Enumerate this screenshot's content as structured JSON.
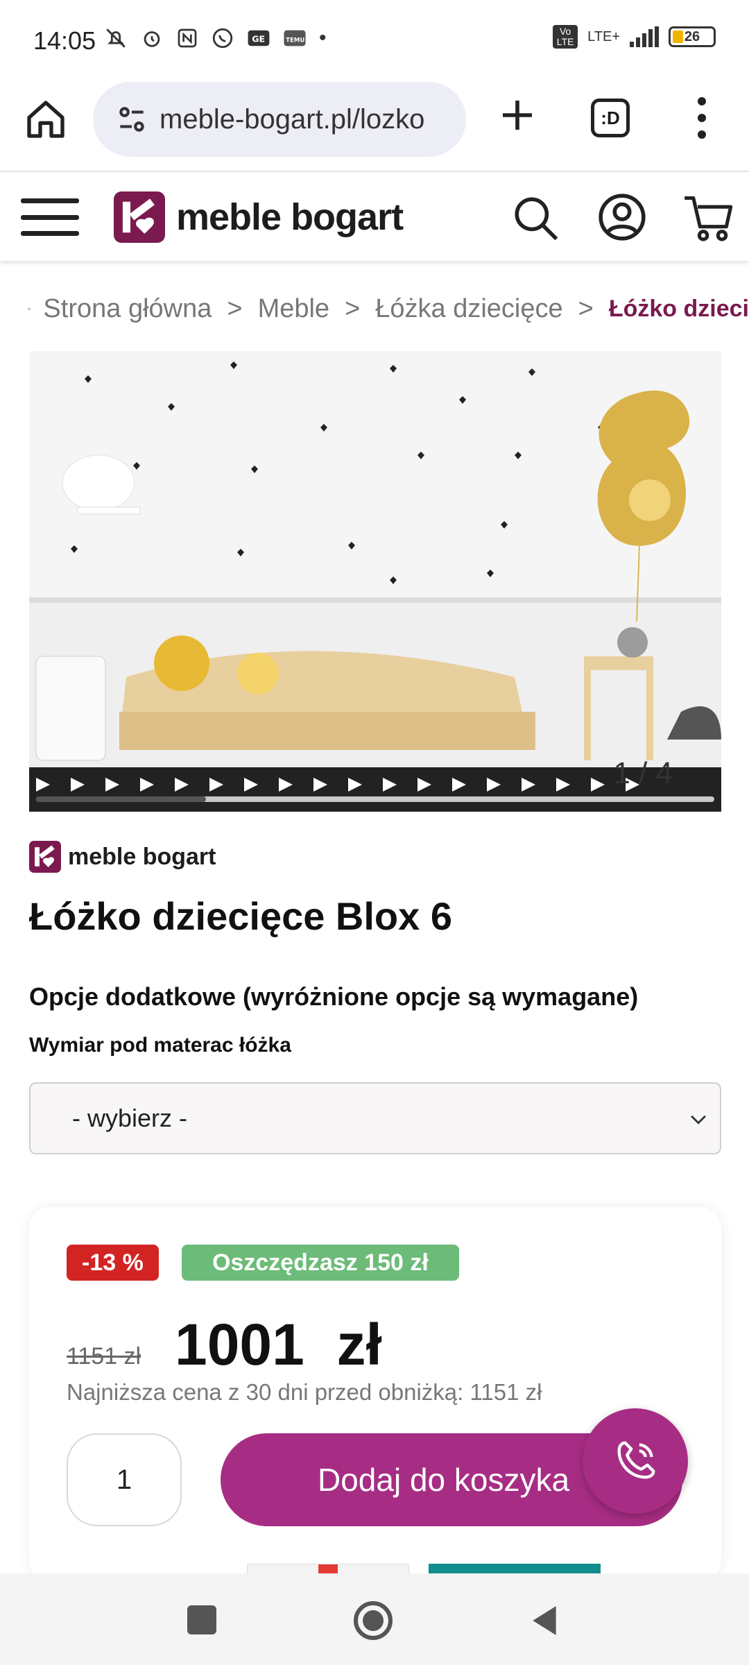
{
  "status_bar": {
    "time": "14:05",
    "network_label": "LTE+",
    "volte_label": "Vo LTE",
    "battery_level": "26",
    "battery_fraction": 0.26
  },
  "browser": {
    "url": "meble-bogart.pl/lozko",
    "tabs_label": ":D"
  },
  "site": {
    "logo_text": "meble bogart",
    "brand_color": "#7a1a4f",
    "accent_color": "#a72d84"
  },
  "breadcrumb": {
    "items": [
      "Strona główna",
      "Meble",
      "Łóżka dziecięce"
    ],
    "current": "Łóżko dzieci",
    "separator": ">"
  },
  "gallery": {
    "counter": "1 / 4",
    "progress_fraction": 0.25
  },
  "product": {
    "brand": "meble bogart",
    "title": "Łóżko dziecięce Blox 6",
    "options_heading": "Opcje dodatkowe (wyróżnione opcje są wymagane)",
    "dimension_label": "Wymiar pod materac łóżka",
    "dimension_select_value": "- wybierz -"
  },
  "pricing": {
    "discount_badge": "-13 %",
    "savings_badge": "Oszczędzasz 150 zł",
    "old_price": "1151 zł",
    "new_price": "1001  zł",
    "lowest_price_note": "Najniższa cena z 30 dni przed obniżką: 1151 zł",
    "quantity": "1",
    "add_to_cart_label": "Dodaj do koszyka"
  },
  "icons": {
    "home": "home-icon",
    "tune": "site-settings-icon",
    "new_tab": "plus-icon",
    "tabs": "tabs-icon",
    "menu": "more-vertical-icon",
    "hamburger": "hamburger-icon",
    "search": "search-icon",
    "account": "account-icon",
    "cart": "cart-icon",
    "call": "phone-call-icon",
    "chevron": "chevron-down-icon"
  }
}
